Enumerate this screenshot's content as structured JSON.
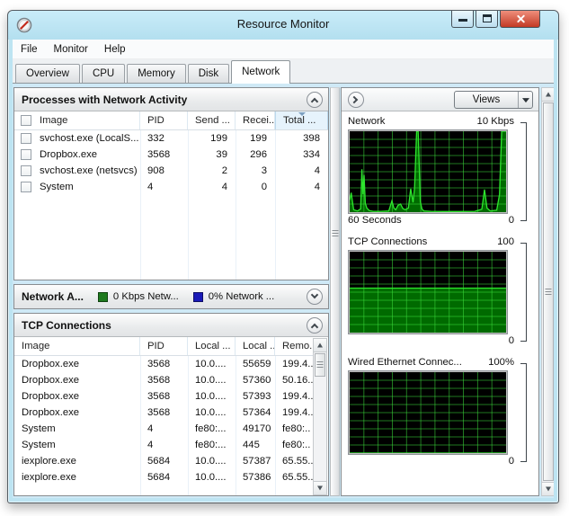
{
  "window": {
    "title": "Resource Monitor"
  },
  "menu": {
    "items": [
      "File",
      "Monitor",
      "Help"
    ]
  },
  "tabs": {
    "items": [
      "Overview",
      "CPU",
      "Memory",
      "Disk",
      "Network"
    ],
    "active": "Network"
  },
  "left": {
    "processes": {
      "title": "Processes with Network Activity",
      "columns": [
        "Image",
        "PID",
        "Send ...",
        "Recei...",
        "Total ..."
      ],
      "sorted_column": "Total ...",
      "rows": [
        {
          "image": "svchost.exe (LocalS...",
          "pid": "332",
          "send": "199",
          "recv": "199",
          "total": "398"
        },
        {
          "image": "Dropbox.exe",
          "pid": "3568",
          "send": "39",
          "recv": "296",
          "total": "334"
        },
        {
          "image": "svchost.exe (netsvcs)",
          "pid": "908",
          "send": "2",
          "recv": "3",
          "total": "4"
        },
        {
          "image": "System",
          "pid": "4",
          "send": "4",
          "recv": "0",
          "total": "4"
        }
      ]
    },
    "network_activity": {
      "title": "Network A...",
      "legend": [
        {
          "label": "0 Kbps Netw...",
          "color": "#1e7a1e"
        },
        {
          "label": "0% Network ...",
          "color": "#1a1ab8"
        }
      ]
    },
    "tcp": {
      "title": "TCP Connections",
      "columns": [
        "Image",
        "PID",
        "Local ...",
        "Local ...",
        "Remo."
      ],
      "rows": [
        {
          "image": "Dropbox.exe",
          "pid": "3568",
          "local_addr": "10.0....",
          "local_port": "55659",
          "remote": "199.4.."
        },
        {
          "image": "Dropbox.exe",
          "pid": "3568",
          "local_addr": "10.0....",
          "local_port": "57360",
          "remote": "50.16.."
        },
        {
          "image": "Dropbox.exe",
          "pid": "3568",
          "local_addr": "10.0....",
          "local_port": "57393",
          "remote": "199.4.."
        },
        {
          "image": "Dropbox.exe",
          "pid": "3568",
          "local_addr": "10.0....",
          "local_port": "57364",
          "remote": "199.4.."
        },
        {
          "image": "System",
          "pid": "4",
          "local_addr": "fe80:...",
          "local_port": "49170",
          "remote": "fe80:.."
        },
        {
          "image": "System",
          "pid": "4",
          "local_addr": "fe80:...",
          "local_port": "445",
          "remote": "fe80:.."
        },
        {
          "image": "iexplore.exe",
          "pid": "5684",
          "local_addr": "10.0....",
          "local_port": "57387",
          "remote": "65.55.."
        },
        {
          "image": "iexplore.exe",
          "pid": "5684",
          "local_addr": "10.0....",
          "local_port": "57386",
          "remote": "65.55.."
        }
      ]
    }
  },
  "right": {
    "views_label": "Views"
  },
  "icons": {
    "app": "resource-monitor-gauge",
    "panel_expanded": "chevron-up",
    "panel_collapsed": "chevron-down",
    "right_pane_toggle": "chevron-right",
    "views_dropdown": "triangle-down"
  },
  "colors": {
    "titlebar": "#bde4f2",
    "close_button": "#c23a25",
    "sort_highlight": "#e6f3fc",
    "chart_bg": "#000000",
    "chart_line": "#2ee52e",
    "chart_fill": "#006a00",
    "legend_green": "#1e7a1e",
    "legend_blue": "#1a1ab8"
  },
  "chart_data": [
    {
      "type": "area",
      "title": "Network",
      "scale_label": "10 Kbps",
      "bottom_left_label": "60 Seconds",
      "bottom_right_label": "0",
      "ylim": [
        0,
        10
      ],
      "x": [
        0.0,
        0.01,
        0.025,
        0.05,
        0.07,
        0.078,
        0.085,
        0.092,
        0.1,
        0.11,
        0.125,
        0.15,
        0.2,
        0.25,
        0.27,
        0.283,
        0.295,
        0.31,
        0.325,
        0.34,
        0.355,
        0.375,
        0.39,
        0.405,
        0.415,
        0.428,
        0.438,
        0.452,
        0.462,
        0.475,
        0.52,
        0.6,
        0.7,
        0.8,
        0.845,
        0.862,
        0.878,
        0.9,
        0.94,
        0.958,
        0.972,
        0.985,
        1.0
      ],
      "y": [
        1.5,
        2.4,
        0.3,
        0.15,
        0.4,
        5.3,
        2.2,
        4.6,
        1.1,
        0.5,
        0.2,
        0.1,
        0.1,
        0.15,
        1.4,
        0.5,
        0.3,
        0.85,
        1.0,
        0.45,
        0.3,
        0.5,
        2.9,
        1.2,
        3.0,
        10.0,
        10.0,
        1.3,
        0.4,
        0.15,
        0.1,
        0.08,
        0.08,
        0.1,
        0.35,
        2.8,
        0.5,
        0.15,
        0.25,
        2.2,
        10.0,
        10.0,
        10.0
      ],
      "grid": {
        "v": 11,
        "h": 10
      },
      "bg": "#000000",
      "grid_color": "rgba(60,220,60,0.55)",
      "line_color": "#2ee52e",
      "fill_color": "#006a00",
      "legend_position": "none"
    },
    {
      "type": "area",
      "title": "TCP Connections",
      "scale_label": "100",
      "bottom_left_label": "",
      "bottom_right_label": "0",
      "ylim": [
        0,
        100
      ],
      "x": [
        0,
        1
      ],
      "y": [
        55,
        55
      ],
      "grid": {
        "v": 11,
        "h": 10
      },
      "bg": "#000000",
      "grid_color": "rgba(60,220,60,0.55)",
      "line_color": "#2ee52e",
      "fill_color": "#006a00",
      "legend_position": "none"
    },
    {
      "type": "area",
      "title": "Wired Ethernet Connec...",
      "scale_label": "100%",
      "bottom_left_label": "",
      "bottom_right_label": "0",
      "ylim": [
        0,
        100
      ],
      "x": [
        0,
        1
      ],
      "y": [
        0,
        0
      ],
      "grid": {
        "v": 11,
        "h": 10
      },
      "bg": "#000000",
      "grid_color": "rgba(60,220,60,0.55)",
      "line_color": "#2ee52e",
      "fill_color": "#006a00",
      "legend_position": "none"
    }
  ]
}
